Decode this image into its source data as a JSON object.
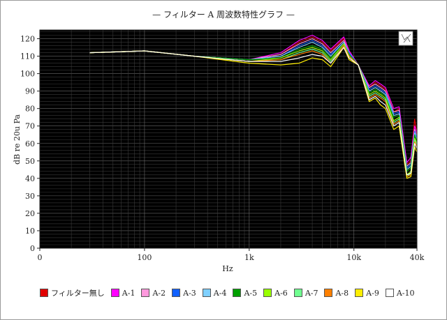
{
  "chart_data": {
    "type": "line",
    "title": "— フィルター A 周波数特性グラフ —",
    "xlabel": "Hz",
    "ylabel": "dB re 20u Pa",
    "xscale": "log",
    "xlim": [
      10,
      40000
    ],
    "ylim": [
      0,
      125
    ],
    "x_ticks": [
      {
        "value": 10,
        "label": "0"
      },
      {
        "value": 100,
        "label": "100"
      },
      {
        "value": 1000,
        "label": "1k"
      },
      {
        "value": 10000,
        "label": "10k"
      },
      {
        "value": 40000,
        "label": "40k"
      }
    ],
    "y_ticks": [
      0,
      10,
      20,
      30,
      40,
      50,
      60,
      70,
      80,
      90,
      100,
      110,
      120
    ],
    "grid": true,
    "background": "#000000",
    "legend_position": "bottom",
    "series": [
      {
        "name": "フィルター無し",
        "color": "#e00000",
        "points": [
          [
            30,
            112
          ],
          [
            100,
            113
          ],
          [
            300,
            110
          ],
          [
            1000,
            108
          ],
          [
            2000,
            111
          ],
          [
            3000,
            118
          ],
          [
            4000,
            121
          ],
          [
            5000,
            118
          ],
          [
            6000,
            113
          ],
          [
            8000,
            120
          ],
          [
            9000,
            113
          ],
          [
            11000,
            105
          ],
          [
            14000,
            92
          ],
          [
            16000,
            95
          ],
          [
            18000,
            93
          ],
          [
            20000,
            91
          ],
          [
            24000,
            78
          ],
          [
            27000,
            80
          ],
          [
            32000,
            48
          ],
          [
            35000,
            50
          ],
          [
            38000,
            74
          ],
          [
            40000,
            65
          ]
        ]
      },
      {
        "name": "A-1",
        "color": "#ff00ff",
        "points": [
          [
            30,
            112
          ],
          [
            100,
            113
          ],
          [
            300,
            110
          ],
          [
            1000,
            108
          ],
          [
            2000,
            112
          ],
          [
            3000,
            119
          ],
          [
            4000,
            122
          ],
          [
            5000,
            119
          ],
          [
            6000,
            114
          ],
          [
            8000,
            121
          ],
          [
            9000,
            113
          ],
          [
            11000,
            105
          ],
          [
            14000,
            93
          ],
          [
            16000,
            96
          ],
          [
            18000,
            94
          ],
          [
            20000,
            92
          ],
          [
            24000,
            80
          ],
          [
            27000,
            81
          ],
          [
            32000,
            49
          ],
          [
            35000,
            52
          ],
          [
            38000,
            70
          ],
          [
            40000,
            66
          ]
        ]
      },
      {
        "name": "A-2",
        "color": "#ff99dd",
        "points": [
          [
            30,
            112
          ],
          [
            100,
            113
          ],
          [
            300,
            110
          ],
          [
            1000,
            108
          ],
          [
            2000,
            111
          ],
          [
            3000,
            117
          ],
          [
            4000,
            120
          ],
          [
            5000,
            117
          ],
          [
            6000,
            112
          ],
          [
            8000,
            119
          ],
          [
            9000,
            112
          ],
          [
            11000,
            105
          ],
          [
            14000,
            92
          ],
          [
            16000,
            94
          ],
          [
            18000,
            92
          ],
          [
            20000,
            90
          ],
          [
            24000,
            78
          ],
          [
            27000,
            79
          ],
          [
            32000,
            47
          ],
          [
            35000,
            49
          ],
          [
            38000,
            68
          ],
          [
            40000,
            64
          ]
        ]
      },
      {
        "name": "A-3",
        "color": "#1060ff",
        "points": [
          [
            30,
            112
          ],
          [
            100,
            113
          ],
          [
            300,
            110
          ],
          [
            1000,
            108
          ],
          [
            2000,
            110
          ],
          [
            3000,
            116
          ],
          [
            4000,
            119
          ],
          [
            5000,
            116
          ],
          [
            6000,
            111
          ],
          [
            8000,
            118
          ],
          [
            9000,
            112
          ],
          [
            11000,
            105
          ],
          [
            14000,
            91
          ],
          [
            16000,
            93
          ],
          [
            18000,
            91
          ],
          [
            20000,
            89
          ],
          [
            24000,
            77
          ],
          [
            27000,
            78
          ],
          [
            32000,
            46
          ],
          [
            35000,
            48
          ],
          [
            38000,
            67
          ],
          [
            40000,
            63
          ]
        ]
      },
      {
        "name": "A-4",
        "color": "#80d0ff",
        "points": [
          [
            30,
            112
          ],
          [
            100,
            113
          ],
          [
            300,
            110
          ],
          [
            1000,
            108
          ],
          [
            2000,
            110
          ],
          [
            3000,
            115
          ],
          [
            4000,
            118
          ],
          [
            5000,
            115
          ],
          [
            6000,
            110
          ],
          [
            8000,
            118
          ],
          [
            9000,
            111
          ],
          [
            11000,
            105
          ],
          [
            14000,
            90
          ],
          [
            16000,
            92
          ],
          [
            18000,
            90
          ],
          [
            20000,
            88
          ],
          [
            24000,
            76
          ],
          [
            27000,
            77
          ],
          [
            32000,
            45
          ],
          [
            35000,
            47
          ],
          [
            38000,
            66
          ],
          [
            40000,
            62
          ]
        ]
      },
      {
        "name": "A-5",
        "color": "#00a000",
        "points": [
          [
            30,
            112
          ],
          [
            100,
            113
          ],
          [
            300,
            110
          ],
          [
            1000,
            108
          ],
          [
            2000,
            109
          ],
          [
            3000,
            114
          ],
          [
            4000,
            116
          ],
          [
            5000,
            114
          ],
          [
            6000,
            109
          ],
          [
            8000,
            117
          ],
          [
            9000,
            111
          ],
          [
            11000,
            105
          ],
          [
            14000,
            89
          ],
          [
            16000,
            91
          ],
          [
            18000,
            89
          ],
          [
            20000,
            87
          ],
          [
            24000,
            75
          ],
          [
            27000,
            76
          ],
          [
            32000,
            44
          ],
          [
            35000,
            46
          ],
          [
            38000,
            65
          ],
          [
            40000,
            61
          ]
        ]
      },
      {
        "name": "A-6",
        "color": "#99ff00",
        "points": [
          [
            30,
            112
          ],
          [
            100,
            113
          ],
          [
            300,
            110
          ],
          [
            1000,
            107
          ],
          [
            2000,
            109
          ],
          [
            3000,
            113
          ],
          [
            4000,
            115
          ],
          [
            5000,
            113
          ],
          [
            6000,
            108
          ],
          [
            8000,
            117
          ],
          [
            9000,
            110
          ],
          [
            11000,
            105
          ],
          [
            14000,
            88
          ],
          [
            16000,
            90
          ],
          [
            18000,
            88
          ],
          [
            20000,
            86
          ],
          [
            24000,
            73
          ],
          [
            27000,
            75
          ],
          [
            32000,
            42
          ],
          [
            35000,
            44
          ],
          [
            38000,
            63
          ],
          [
            40000,
            60
          ]
        ]
      },
      {
        "name": "A-7",
        "color": "#70ff90",
        "points": [
          [
            30,
            112
          ],
          [
            100,
            113
          ],
          [
            300,
            110
          ],
          [
            1000,
            107
          ],
          [
            2000,
            108
          ],
          [
            3000,
            112
          ],
          [
            4000,
            114
          ],
          [
            5000,
            112
          ],
          [
            6000,
            107
          ],
          [
            8000,
            116
          ],
          [
            9000,
            110
          ],
          [
            11000,
            105
          ],
          [
            14000,
            87
          ],
          [
            16000,
            89
          ],
          [
            18000,
            87
          ],
          [
            20000,
            85
          ],
          [
            24000,
            72
          ],
          [
            27000,
            74
          ],
          [
            32000,
            41
          ],
          [
            35000,
            43
          ],
          [
            38000,
            62
          ],
          [
            40000,
            59
          ]
        ]
      },
      {
        "name": "A-8",
        "color": "#ff8000",
        "points": [
          [
            30,
            112
          ],
          [
            100,
            113
          ],
          [
            300,
            110
          ],
          [
            1000,
            107
          ],
          [
            2000,
            108
          ],
          [
            3000,
            111
          ],
          [
            4000,
            113
          ],
          [
            5000,
            111
          ],
          [
            6000,
            106
          ],
          [
            8000,
            116
          ],
          [
            9000,
            110
          ],
          [
            11000,
            105
          ],
          [
            14000,
            86
          ],
          [
            16000,
            88
          ],
          [
            18000,
            86
          ],
          [
            20000,
            84
          ],
          [
            24000,
            71
          ],
          [
            27000,
            73
          ],
          [
            32000,
            41
          ],
          [
            35000,
            42
          ],
          [
            38000,
            61
          ],
          [
            40000,
            58
          ]
        ]
      },
      {
        "name": "A-9",
        "color": "#ffee00",
        "points": [
          [
            30,
            112
          ],
          [
            100,
            113
          ],
          [
            300,
            110
          ],
          [
            1000,
            106
          ],
          [
            2000,
            105
          ],
          [
            3000,
            106
          ],
          [
            4000,
            109
          ],
          [
            5000,
            108
          ],
          [
            6000,
            104
          ],
          [
            8000,
            115
          ],
          [
            9000,
            108
          ],
          [
            11000,
            105
          ],
          [
            14000,
            84
          ],
          [
            16000,
            86
          ],
          [
            18000,
            82
          ],
          [
            20000,
            80
          ],
          [
            24000,
            68
          ],
          [
            27000,
            70
          ],
          [
            32000,
            40
          ],
          [
            35000,
            41
          ],
          [
            38000,
            58
          ],
          [
            40000,
            55
          ]
        ]
      },
      {
        "name": "A-10",
        "color": "#ffffff",
        "points": [
          [
            30,
            112
          ],
          [
            100,
            113
          ],
          [
            300,
            110
          ],
          [
            1000,
            107
          ],
          [
            2000,
            107
          ],
          [
            3000,
            109
          ],
          [
            4000,
            111
          ],
          [
            5000,
            110
          ],
          [
            6000,
            106
          ],
          [
            8000,
            115
          ],
          [
            9000,
            109
          ],
          [
            11000,
            105
          ],
          [
            14000,
            85
          ],
          [
            16000,
            87
          ],
          [
            18000,
            84
          ],
          [
            20000,
            82
          ],
          [
            24000,
            70
          ],
          [
            27000,
            72
          ],
          [
            32000,
            42
          ],
          [
            35000,
            43
          ],
          [
            38000,
            60
          ],
          [
            40000,
            57
          ]
        ]
      }
    ]
  }
}
